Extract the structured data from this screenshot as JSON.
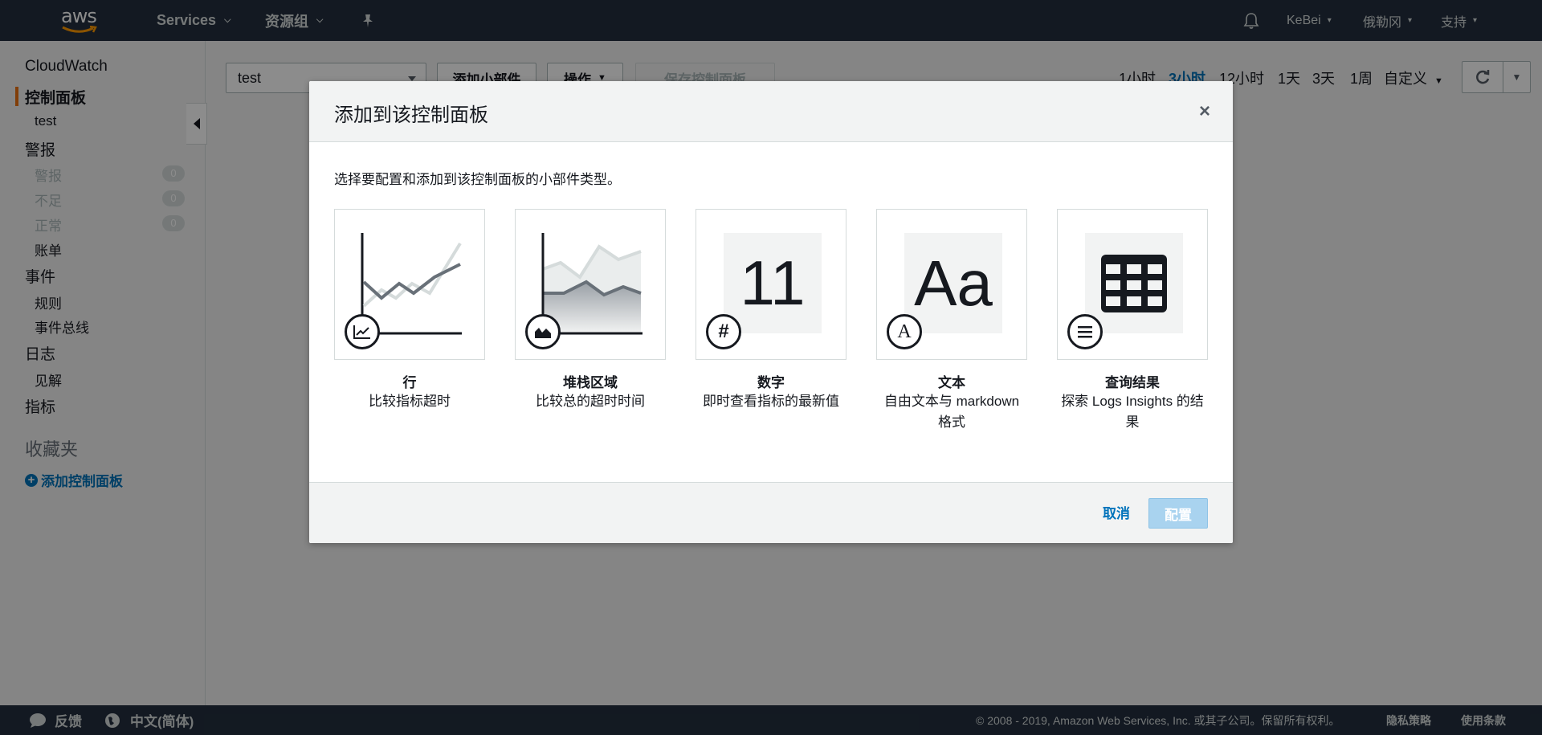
{
  "topnav": {
    "logo_text": "aws",
    "services": "Services",
    "resource_groups": "资源组",
    "user": "KeBei",
    "region": "俄勒冈",
    "support": "支持"
  },
  "sidebar": {
    "cloudwatch": "CloudWatch",
    "dashboards": "控制面板",
    "dashboard_test": "test",
    "alarms": "警报",
    "alarm_state": {
      "label": "警报",
      "count": "0"
    },
    "insufficient": {
      "label": "不足",
      "count": "0"
    },
    "ok": {
      "label": "正常",
      "count": "0"
    },
    "billing": "账单",
    "events": "事件",
    "rules": "规则",
    "event_buses": "事件总线",
    "logs": "日志",
    "insights": "见解",
    "metrics": "指标",
    "favorites": "收藏夹",
    "add_dashboard": "添加控制面板"
  },
  "toolbar": {
    "dashboard_selected": "test",
    "add_widget": "添加小部件",
    "actions": "操作",
    "save_dashboard": "保存控制面板",
    "time_ranges": [
      "1小时",
      "3小时",
      "12小时",
      "1天",
      "3天",
      "1周"
    ],
    "active_time_range": "3小时",
    "custom": "自定义"
  },
  "modal": {
    "title": "添加到该控制面板",
    "description": "选择要配置和添加到该控制面板的小部件类型。",
    "widgets": [
      {
        "title": "行",
        "desc": "比较指标超时",
        "icon": "line-chart-icon"
      },
      {
        "title": "堆栈区域",
        "desc": "比较总的超时时间",
        "icon": "area-chart-icon"
      },
      {
        "title": "数字",
        "desc": "即时查看指标的最新值",
        "icon": "hash-icon",
        "sample": "11"
      },
      {
        "title": "文本",
        "desc": "自由文本与 markdown 格式",
        "icon": "text-icon",
        "sample": "Aa"
      },
      {
        "title": "查询结果",
        "desc": "探索 Logs Insights 的结果",
        "icon": "list-icon"
      }
    ],
    "cancel": "取消",
    "configure": "配置",
    "close_symbol": "×"
  },
  "footer": {
    "feedback": "反馈",
    "language": "中文(简体)",
    "copyright": "© 2008 - 2019, Amazon Web Services, Inc. 或其子公司。保留所有权利。",
    "privacy": "隐私策略",
    "terms": "使用条款"
  },
  "colors": {
    "nav_bg": "#232f3e",
    "accent": "#ec7211",
    "link": "#0073bb",
    "primary_disabled": "#a9d3ef"
  }
}
